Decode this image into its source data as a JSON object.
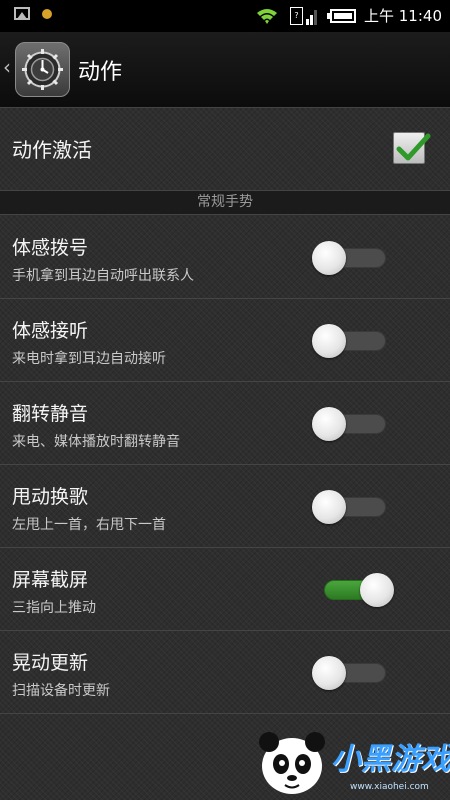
{
  "status_bar": {
    "time": "上午 11:40",
    "icons": [
      "image-icon",
      "notification-dot-icon",
      "wifi-icon",
      "sim-signal-icon",
      "battery-icon"
    ]
  },
  "title_bar": {
    "title": "动作",
    "back_icon": "chevron-left-icon",
    "app_icon": "settings-gear-icon"
  },
  "master": {
    "label": "动作激活",
    "checked": true
  },
  "section": {
    "title": "常规手势"
  },
  "settings": [
    {
      "title": "体感拨号",
      "subtitle": "手机拿到耳边自动呼出联系人",
      "enabled": false
    },
    {
      "title": "体感接听",
      "subtitle": "来电时拿到耳边自动接听",
      "enabled": false
    },
    {
      "title": "翻转静音",
      "subtitle": "来电、媒体播放时翻转静音",
      "enabled": false
    },
    {
      "title": "甩动换歌",
      "subtitle": "左甩上一首，右甩下一首",
      "enabled": false
    },
    {
      "title": "屏幕截屏",
      "subtitle": "三指向上推动",
      "enabled": true
    },
    {
      "title": "晃动更新",
      "subtitle": "扫描设备时更新",
      "enabled": false
    }
  ],
  "watermark": {
    "text": "小黑游戏",
    "url": "www.xiaohei.com"
  },
  "colors": {
    "accent_green": "#3f9b32",
    "background": "#2e2e2e",
    "divider": "#454545",
    "watermark_blue": "#3aa0ff"
  }
}
